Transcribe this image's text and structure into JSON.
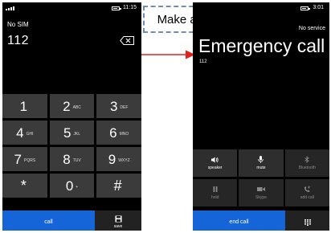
{
  "dialer": {
    "status": {
      "time": "11:15"
    },
    "carrier": "No SIM",
    "number": "112",
    "keys": [
      [
        {
          "digit": "1",
          "letters": ""
        },
        {
          "digit": "2",
          "letters": "ABC"
        },
        {
          "digit": "3",
          "letters": "DEF"
        }
      ],
      [
        {
          "digit": "4",
          "letters": "GHI"
        },
        {
          "digit": "5",
          "letters": "JKL"
        },
        {
          "digit": "6",
          "letters": "MNO"
        }
      ],
      [
        {
          "digit": "7",
          "letters": "PQRS"
        },
        {
          "digit": "8",
          "letters": "TUV"
        },
        {
          "digit": "9",
          "letters": "WXYZ"
        }
      ],
      [
        {
          "digit": "*",
          "letters": ""
        },
        {
          "digit": "0",
          "letters": "+"
        },
        {
          "digit": "#",
          "letters": ""
        }
      ]
    ],
    "call_label": "call",
    "save_label": "save",
    "icons": {
      "backspace": "backspace-icon",
      "save": "floppy-disk-icon"
    }
  },
  "annotation": {
    "callout": "Make a call",
    "arrow_color": "#e0201c"
  },
  "emergency": {
    "status": {
      "time": "3:01"
    },
    "service": "No service",
    "title": "Emergency call",
    "number": "112",
    "controls": [
      [
        {
          "label": "speaker",
          "icon": "speaker-icon",
          "enabled": true
        },
        {
          "label": "mute",
          "icon": "microphone-icon",
          "enabled": true
        },
        {
          "label": "Bluetooth",
          "icon": "bluetooth-icon",
          "enabled": false
        }
      ],
      [
        {
          "label": "hold",
          "icon": "pause-icon",
          "enabled": false
        },
        {
          "label": "Skype",
          "icon": "video-camera-icon",
          "enabled": false
        },
        {
          "label": "add call",
          "icon": "add-call-icon",
          "enabled": false
        }
      ]
    ],
    "end_call_label": "end call",
    "icons": {
      "keypad": "keypad-icon"
    }
  },
  "colors": {
    "accent": "#1565d8",
    "key_bg": "#3b3b3b",
    "callout_border": "#6d8fb8"
  }
}
